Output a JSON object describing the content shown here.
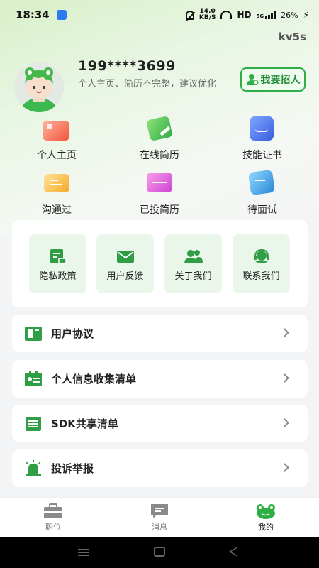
{
  "status_bar": {
    "time": "18:34",
    "speed_value": "14.0",
    "speed_unit": "KB/S",
    "hd": "HD",
    "network": "5G",
    "battery": "26%"
  },
  "device_label": "kv5s",
  "profile": {
    "phone": "199****3699",
    "hint": "个人主页、简历不完整，建议优化",
    "recruit_button": "我要招人"
  },
  "quick_links": [
    {
      "label": "个人主页",
      "icon": "homepage-icon"
    },
    {
      "label": "在线简历",
      "icon": "resume-edit-icon"
    },
    {
      "label": "技能证书",
      "icon": "certificate-icon"
    },
    {
      "label": "沟通过",
      "icon": "chat-icon"
    },
    {
      "label": "已投简历",
      "icon": "sent-resume-icon"
    },
    {
      "label": "待面试",
      "icon": "interview-icon"
    }
  ],
  "service_tiles": [
    {
      "label": "隐私政策",
      "icon": "privacy-doc-icon"
    },
    {
      "label": "用户反馈",
      "icon": "mail-icon"
    },
    {
      "label": "关于我们",
      "icon": "users-icon"
    },
    {
      "label": "联系我们",
      "icon": "headset-icon"
    }
  ],
  "list_rows": [
    {
      "label": "用户协议",
      "icon": "book-icon"
    },
    {
      "label": "个人信息收集清单",
      "icon": "id-card-icon"
    },
    {
      "label": "SDK共享清单",
      "icon": "list-icon"
    },
    {
      "label": "投诉举报",
      "icon": "alarm-icon"
    }
  ],
  "bottom_nav": [
    {
      "label": "职位",
      "icon": "briefcase-icon"
    },
    {
      "label": "消息",
      "icon": "message-icon"
    },
    {
      "label": "我的",
      "icon": "frog-icon"
    }
  ],
  "colors": {
    "accent": "#2fae45",
    "tile_bg": "#eaf6ea"
  }
}
